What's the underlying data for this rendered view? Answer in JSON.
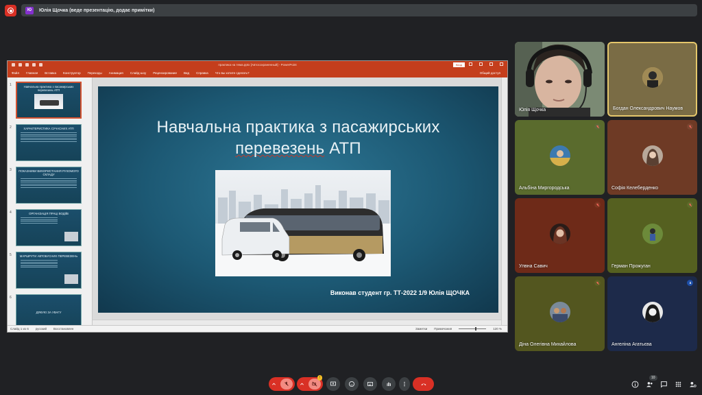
{
  "presenting_banner": {
    "avatar_initials": "Ю",
    "text": "Юлія Щочка (веде презентацію, додає примітки)"
  },
  "powerpoint": {
    "window_title": "практика на тема.pptx [Автосохраненный] - PowerPoint",
    "sign_in_label": "Вход",
    "menu": [
      "Файл",
      "Главная",
      "Вставка",
      "Конструктор",
      "Переходы",
      "Анимация",
      "Слайд-шоу",
      "Рецензирование",
      "Вид",
      "Справка",
      "Что вы хотите сделать?"
    ],
    "share_label": "Общий доступ",
    "thumbnails": [
      {
        "num": "1",
        "title": "Навчальна практика з пасажирських перевезень АТП",
        "selected": true
      },
      {
        "num": "2",
        "title": "ХАРАКТЕРИСТИКА СУЧАСНИХ АТП"
      },
      {
        "num": "3",
        "title": "ПОКАЗНИКИ ВИКОРИСТАННЯ РУХОМОГО СКЛАДУ"
      },
      {
        "num": "4",
        "title": "ОРГАНІЗАЦІЯ ПРАЦІ ВОДІЇВ"
      },
      {
        "num": "5",
        "title": "МАРШРУТИ АВТОБУСНИХ ПЕРЕВЕЗЕНЬ"
      },
      {
        "num": "6",
        "title": "ДЯКУЮ ЗА УВАГУ"
      }
    ],
    "slide": {
      "title_line1": "Навчальна практика з пасажирських",
      "title_line2_underlined": "перевезень",
      "title_line2_rest": " АТП",
      "author": "Виконав студент гр. ТТ-2022 1/9 Юлія ЩОЧКА"
    },
    "status": {
      "slide_of": "Слайд 1 из 6",
      "language": "русский",
      "recovered": "Восстановлен",
      "notes": "Заметки",
      "comments": "Примечания",
      "zoom": "120 %"
    }
  },
  "participants": [
    {
      "name": "Юлія Щочка",
      "video": true,
      "muted": false
    },
    {
      "name": "Богдан Олександрович Наумов",
      "video": false,
      "muted": false,
      "active": true
    },
    {
      "name": "Альбіна Миргородська",
      "video": false,
      "muted": true
    },
    {
      "name": "Софія Келеберденко",
      "video": false,
      "muted": true
    },
    {
      "name": "Улвна Савич",
      "video": false,
      "muted": true
    },
    {
      "name": "Герман Прожуган",
      "video": false,
      "muted": true
    },
    {
      "name": "Діна Олегівна Михайлова",
      "video": false,
      "muted": true
    },
    {
      "name": "Ангеліна Агатьєва",
      "video": false,
      "muted": false
    }
  ],
  "toolbar": {
    "participants_count": "10",
    "camera_badge": "!"
  },
  "colors": {
    "accent_red": "#d93025",
    "ppt_orange": "#c43e1c",
    "meet_bg": "#202124"
  }
}
